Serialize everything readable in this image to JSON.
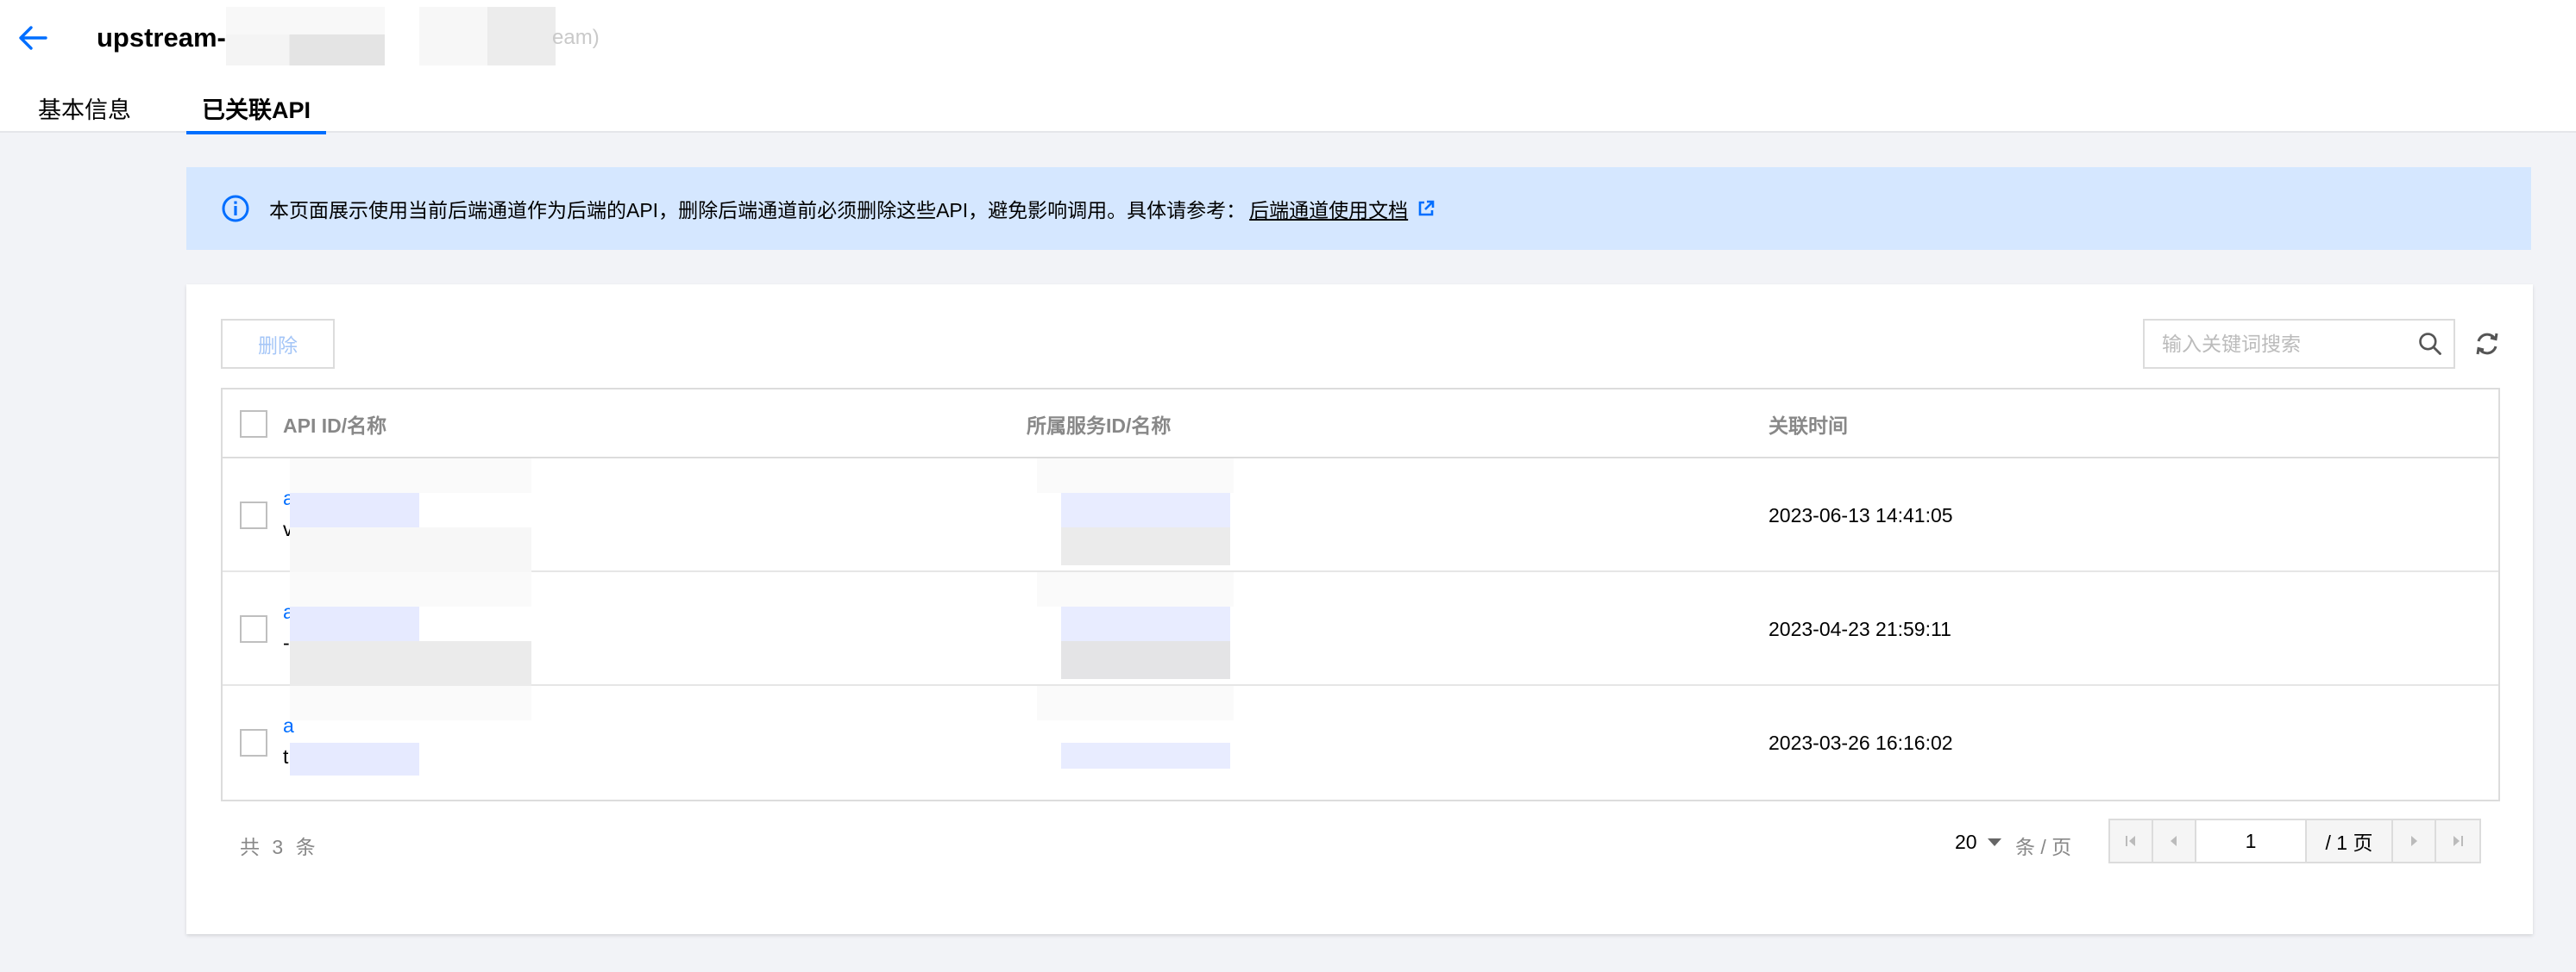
{
  "header": {
    "title": "upstream-",
    "title_suffix": "eam)",
    "tabs": [
      {
        "label": "基本信息",
        "active": false
      },
      {
        "label": "已关联API",
        "active": true
      }
    ]
  },
  "alert": {
    "text": "本页面展示使用当前后端通道作为后端的API，删除后端通道前必须删除这些API，避免影响调用。具体请参考：",
    "link": "后端通道使用文档"
  },
  "toolbar": {
    "delete_label": "删除",
    "search_placeholder": "输入关键词搜索"
  },
  "table": {
    "columns": [
      "API ID/名称",
      "所属服务ID/名称",
      "关联时间"
    ],
    "rows": [
      {
        "api_id": "a",
        "api_name": "v",
        "time": "2023-06-13 14:41:05"
      },
      {
        "api_id": "a",
        "api_name": "-",
        "time": "2023-04-23 21:59:11"
      },
      {
        "api_id": "a",
        "api_name": "t",
        "time": "2023-03-26 16:16:02"
      }
    ]
  },
  "pagination": {
    "total": "共 3 条",
    "page_size": "20",
    "page_size_unit": "条 / 页",
    "current_page": "1",
    "total_pages": "/ 1 页"
  },
  "colors": {
    "accent": "#006eff",
    "alert_bg": "#d5e7ff"
  }
}
